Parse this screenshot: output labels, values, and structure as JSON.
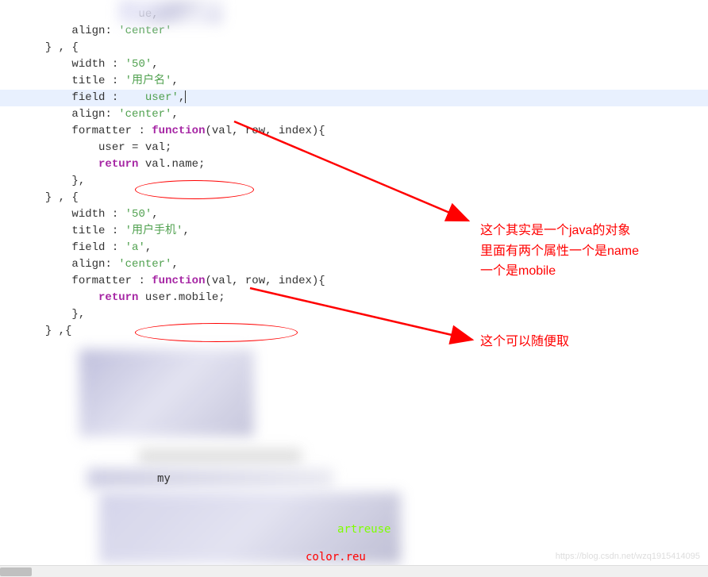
{
  "code": {
    "line1_suffix": "ue,",
    "align": "align",
    "center": "'center'",
    "brace_close_comma_brace": "} , {",
    "width": "width",
    "w50": "'50'",
    "title": "title",
    "username": "'用户名'",
    "field": "field",
    "field_user": "user'",
    "formatter": "formatter",
    "function": "function",
    "params": "(val, row, index){",
    "user_assign": "user = val;",
    "return": "return",
    "val_name": "val.name;",
    "close_bracket": "},",
    "usermobile": "'用户手机'",
    "field_a": "'a'",
    "user_mobile_stmt": "user.mobile;",
    "brace_close_comma_open": "} ,{",
    "my_fragment": "my",
    "artreuse": "artreuse",
    "color_red_frag": "color.reu"
  },
  "annotations": {
    "ann1_line1": "这个其实是一个java的对象",
    "ann1_line2": "里面有两个属性一个是name",
    "ann1_line3": "一个是mobile",
    "ann2": "这个可以随便取"
  },
  "watermark": "https://blog.csdn.net/wzq1915414095"
}
